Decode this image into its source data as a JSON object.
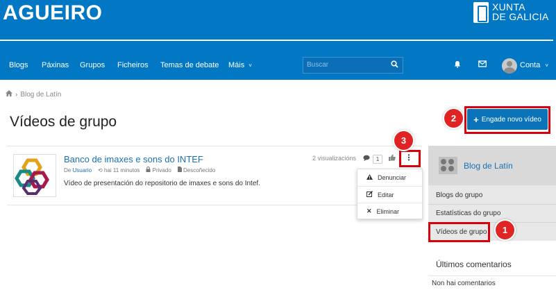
{
  "header": {
    "brand": "AGUEIRO",
    "gov_line1": "XUNTA",
    "gov_line2": "DE GALICIA",
    "bg_color": "#0277c4"
  },
  "nav": {
    "items": [
      "Blogs",
      "Páxinas",
      "Grupos",
      "Ficheiros",
      "Temas de debate",
      "Máis"
    ],
    "more_caret": "˅",
    "search_placeholder": "Buscar",
    "account_label": "Conta",
    "account_caret": "˅"
  },
  "breadcrumb": {
    "sep": "›",
    "item": "Blog de Latín"
  },
  "page": {
    "title": "Vídeos de grupo"
  },
  "add_button": {
    "label": "Engade novo vídeo",
    "color": "#0b74b8"
  },
  "badges": {
    "one": "1",
    "two": "2",
    "three": "3",
    "color": "#e02424"
  },
  "video": {
    "title": "Banco de imaxes e sons do INTEF",
    "by": "De",
    "user": "Usuario",
    "time": "hai 11 minutos",
    "privacy": "Privado",
    "category": "Descoñecido",
    "description": "Vídeo de presentación do repositorio de imaxes e sons do Intef.",
    "views": "2 visualizacións",
    "comment_count": "1"
  },
  "menu": {
    "items": [
      {
        "label": "Denunciar",
        "icon": "warning-icon"
      },
      {
        "label": "Editar",
        "icon": "edit-icon"
      },
      {
        "label": "Eliminar",
        "icon": "delete-icon"
      }
    ]
  },
  "sidebar": {
    "group_name": "Blog de Latín",
    "links": [
      "Blogs do grupo",
      "Estatísticas do grupo",
      "Vídeos de grupo"
    ],
    "last_comments_title": "Últimos comentarios",
    "no_comments": "Non hai comentarios"
  }
}
